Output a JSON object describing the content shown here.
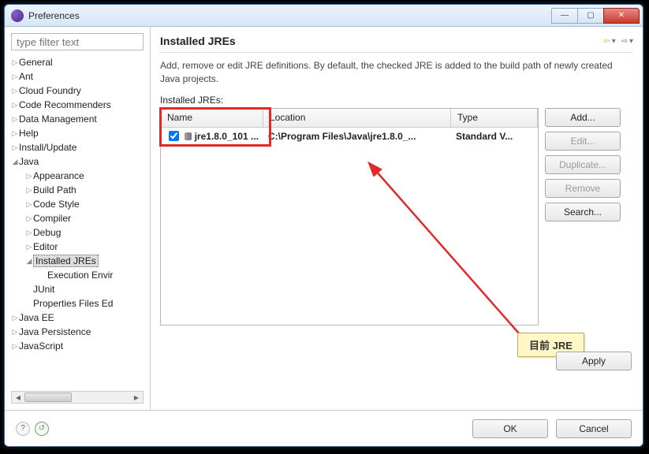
{
  "window": {
    "title": "Preferences"
  },
  "filter": {
    "placeholder": "type filter text"
  },
  "tree": [
    {
      "label": "General",
      "indent": 0,
      "expand": "▷"
    },
    {
      "label": "Ant",
      "indent": 0,
      "expand": "▷"
    },
    {
      "label": "Cloud Foundry",
      "indent": 0,
      "expand": "▷"
    },
    {
      "label": "Code Recommenders",
      "indent": 0,
      "expand": "▷"
    },
    {
      "label": "Data Management",
      "indent": 0,
      "expand": "▷"
    },
    {
      "label": "Help",
      "indent": 0,
      "expand": "▷"
    },
    {
      "label": "Install/Update",
      "indent": 0,
      "expand": "▷"
    },
    {
      "label": "Java",
      "indent": 0,
      "expand": "◢"
    },
    {
      "label": "Appearance",
      "indent": 1,
      "expand": "▷"
    },
    {
      "label": "Build Path",
      "indent": 1,
      "expand": "▷"
    },
    {
      "label": "Code Style",
      "indent": 1,
      "expand": "▷"
    },
    {
      "label": "Compiler",
      "indent": 1,
      "expand": "▷"
    },
    {
      "label": "Debug",
      "indent": 1,
      "expand": "▷"
    },
    {
      "label": "Editor",
      "indent": 1,
      "expand": "▷"
    },
    {
      "label": "Installed JREs",
      "indent": 1,
      "expand": "◢",
      "selected": true
    },
    {
      "label": "Execution Envir",
      "indent": 2,
      "expand": ""
    },
    {
      "label": "JUnit",
      "indent": 1,
      "expand": ""
    },
    {
      "label": "Properties Files Ed",
      "indent": 1,
      "expand": ""
    },
    {
      "label": "Java EE",
      "indent": 0,
      "expand": "▷"
    },
    {
      "label": "Java Persistence",
      "indent": 0,
      "expand": "▷"
    },
    {
      "label": "JavaScript",
      "indent": 0,
      "expand": "▷"
    }
  ],
  "page": {
    "title": "Installed JREs",
    "description": "Add, remove or edit JRE definitions. By default, the checked JRE is added to the build path of newly created Java projects.",
    "table_label": "Installed JREs:",
    "columns": {
      "name": "Name",
      "location": "Location",
      "type": "Type"
    },
    "rows": [
      {
        "checked": true,
        "name": "jre1.8.0_101 ...",
        "location": "C:\\Program Files\\Java\\jre1.8.0_...",
        "type": "Standard V..."
      }
    ],
    "buttons": {
      "add": "Add...",
      "edit": "Edit...",
      "duplicate": "Duplicate...",
      "remove": "Remove",
      "search": "Search...",
      "apply": "Apply",
      "ok": "OK",
      "cancel": "Cancel"
    }
  },
  "annotation": {
    "label": "目前 JRE"
  }
}
